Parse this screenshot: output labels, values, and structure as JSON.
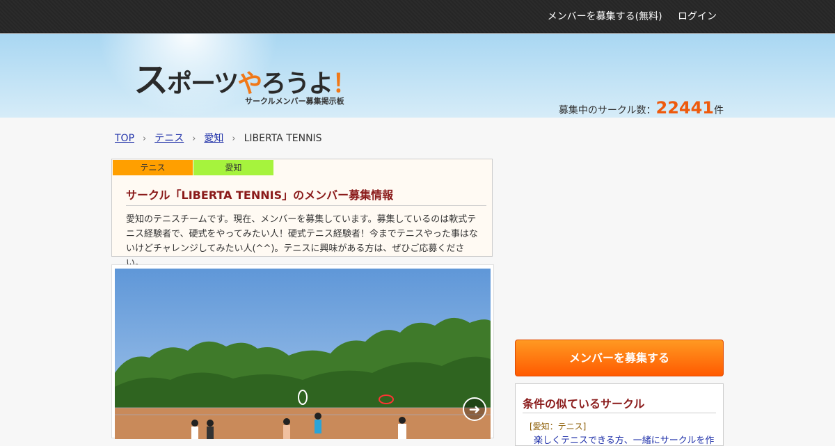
{
  "topnav": {
    "recruit_free": "メンバーを募集する(無料)",
    "login": "ログイン"
  },
  "logo": {
    "part1": "ス",
    "part2": "ポーツ",
    "part3": "や",
    "part4": "ろうよ",
    "exclaim": "！",
    "sub": "サークルメンバー募集掲示板"
  },
  "count": {
    "label": "募集中のサークル数：",
    "value": "22441",
    "unit": "件"
  },
  "breadcrumb": {
    "top": "TOP",
    "sport": "テニス",
    "area": "愛知",
    "current": "LIBERTA TENNIS"
  },
  "info": {
    "tags": [
      "テニス",
      "愛知"
    ],
    "title": "サークル「LIBERTA TENNIS」のメンバー募集情報",
    "description": "愛知のテニスチームです。現在、メンバーを募集しています。募集しているのは軟式テニス経験者で、硬式をやってみたい人！硬式テニス経験者！今までテニスやった事はないけどチャレンジしてみたい人(^^)。テニスに興味がある方は、ぜひご応募ください。"
  },
  "sidebar": {
    "recruit_button": "メンバーを募集する",
    "similar_title": "条件の似ているサークル",
    "similar_category": "[愛知：テニス]",
    "similar_item": "楽しくテニスできる方、一緒にサークルを作"
  },
  "colors": {
    "accent": "#ee5a0d",
    "title": "#8a1a1a",
    "tag_sport": "#ff9f00",
    "tag_area": "#a6f33d"
  }
}
